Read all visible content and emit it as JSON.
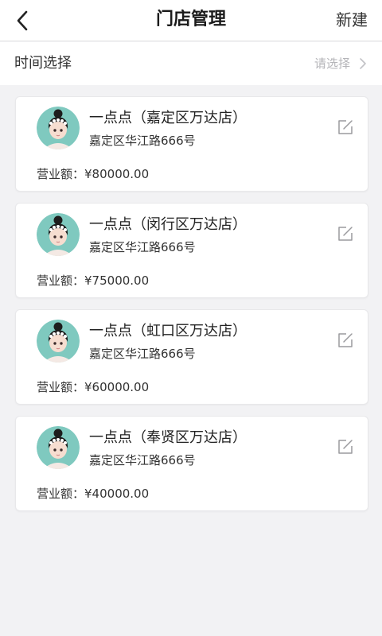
{
  "header": {
    "title": "门店管理",
    "action_label": "新建",
    "back_icon": "chevron-left-icon"
  },
  "filter": {
    "label": "时间选择",
    "value": "请选择",
    "chevron_icon": "chevron-right-icon"
  },
  "stores": [
    {
      "name": "一点点（嘉定区万达店）",
      "address": "嘉定区华江路666号",
      "revenue_label": "营业额：",
      "revenue": "¥80000.00"
    },
    {
      "name": "一点点（闵行区万达店）",
      "address": "嘉定区华江路666号",
      "revenue_label": "营业额：",
      "revenue": "¥75000.00"
    },
    {
      "name": "一点点（虹口区万达店）",
      "address": "嘉定区华江路666号",
      "revenue_label": "营业额：",
      "revenue": "¥60000.00"
    },
    {
      "name": "一点点（奉贤区万达店）",
      "address": "嘉定区华江路666号",
      "revenue_label": "营业额：",
      "revenue": "¥40000.00"
    }
  ],
  "colors": {
    "background": "#f2f2f4",
    "card": "#ffffff",
    "avatar_bg": "#7fc9bf",
    "placeholder": "#b4b4b8"
  },
  "icons": {
    "edit": "edit-icon",
    "avatar": "avatar"
  }
}
